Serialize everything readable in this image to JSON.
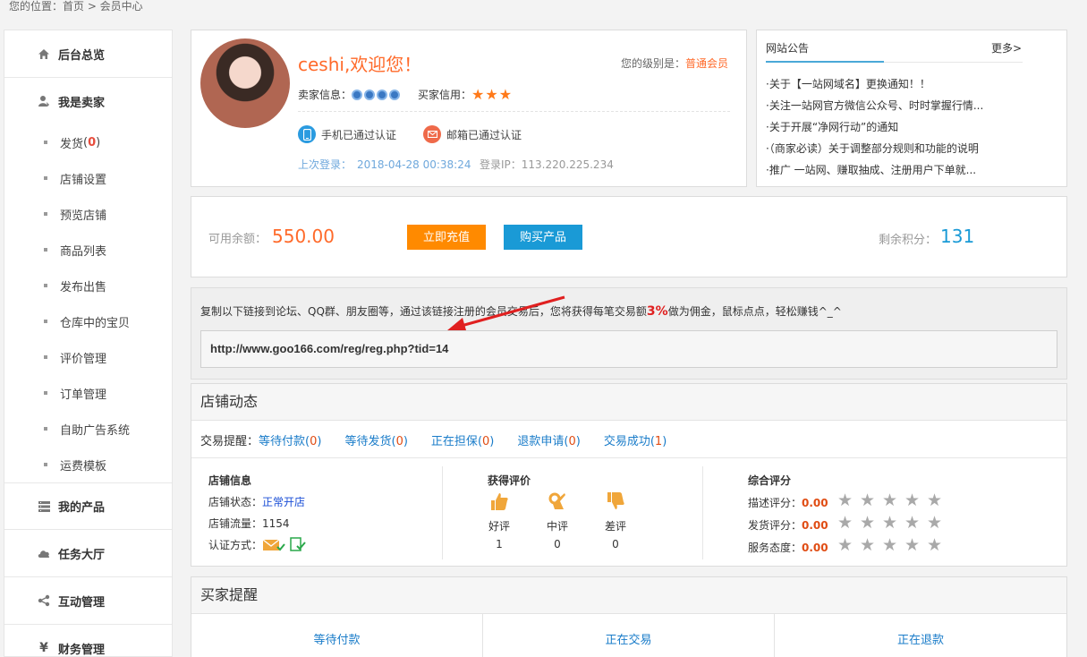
{
  "breadcrumb": "您的位置：首页 > 会员中心",
  "sidebar": {
    "dashboard": "后台总览",
    "seller": "我是卖家",
    "sub_items": [
      {
        "label": "发货",
        "count": "0"
      },
      {
        "label": "店铺设置"
      },
      {
        "label": "预览店铺"
      },
      {
        "label": "商品列表"
      },
      {
        "label": "发布出售"
      },
      {
        "label": "仓库中的宝贝"
      },
      {
        "label": "评价管理"
      },
      {
        "label": "订单管理"
      },
      {
        "label": "自助广告系统"
      },
      {
        "label": "运费模板"
      }
    ],
    "my_products": "我的产品",
    "task_hall": "任务大厅",
    "interaction": "互动管理",
    "finance": "财务管理"
  },
  "profile": {
    "greeting": "ceshi,欢迎您！",
    "level_label": "您的级别是：",
    "level_value": "普通会员",
    "seller_info_label": "卖家信息：",
    "buyer_credit_label": "买家信用：",
    "phone_verified": "手机已通过认证",
    "email_verified": "邮箱已通过认证",
    "last_login_label": "上次登录：",
    "last_login_value": "2018-04-28 00:38:24",
    "login_ip": "登录IP：113.220.225.234"
  },
  "notice": {
    "title": "网站公告",
    "more": "更多>",
    "items": [
      "·关于【一站网域名】更换通知！！",
      "·关注一站网官方微信公众号、时时掌握行情...",
      "·关于开展“净网行动”的通知",
      "·（商家必读）关于调整部分规则和功能的说明",
      "·推广 一站网、赚取抽成、注册用户下单就..."
    ]
  },
  "balance": {
    "label": "可用余额：",
    "value": "550.00",
    "recharge_btn": "立即充值",
    "buy_btn": "购买产品",
    "score_label": "剩余积分：",
    "score_value": "131"
  },
  "referral": {
    "text_before": "复制以下链接到论坛、QQ群、朋友圈等，通过该链接注册的会员交易后，您将获得每笔交易额",
    "percent": "3%",
    "text_after": "做为佣金，鼠标点点，轻松赚钱^_^",
    "link": "http://www.goo166.com/reg/reg.php?tid=14"
  },
  "shop": {
    "title": "店铺动态",
    "trade_label": "交易提醒：",
    "trade_links": [
      {
        "label": "等待付款",
        "count": "0"
      },
      {
        "label": "等待发货",
        "count": "0"
      },
      {
        "label": "正在担保",
        "count": "0"
      },
      {
        "label": "退款申请",
        "count": "0"
      },
      {
        "label": "交易成功",
        "count": "1"
      }
    ],
    "info_title": "店铺信息",
    "status_label": "店铺状态：",
    "status_value": "正常开店",
    "traffic": "店铺流量：1154",
    "auth_label": "认证方式：",
    "eval_title": "获得评价",
    "evals": [
      {
        "label": "好评",
        "count": "1"
      },
      {
        "label": "中评",
        "count": "0"
      },
      {
        "label": "差评",
        "count": "0"
      }
    ],
    "rating_title": "综合评分",
    "ratings": [
      {
        "label": "描述评分：",
        "value": "0.00"
      },
      {
        "label": "发货评分：",
        "value": "0.00"
      },
      {
        "label": "服务态度：",
        "value": "0.00"
      }
    ]
  },
  "buyer": {
    "title": "买家提醒",
    "cols": [
      "等待付款",
      "正在交易",
      "正在退款"
    ]
  }
}
